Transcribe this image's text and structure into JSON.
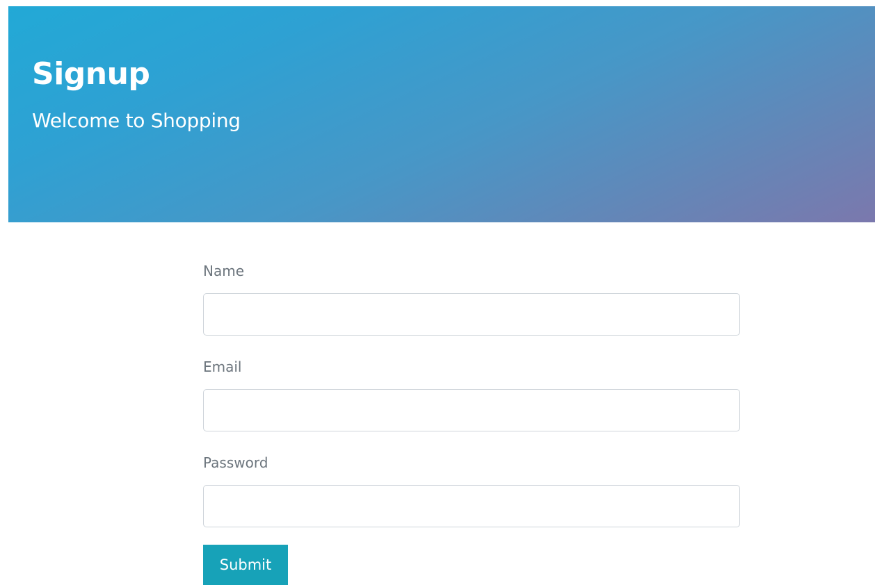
{
  "header": {
    "title": "Signup",
    "subtitle": "Welcome to Shopping"
  },
  "form": {
    "fields": [
      {
        "label": "Name",
        "value": "",
        "type": "text"
      },
      {
        "label": "Email",
        "value": "",
        "type": "email"
      },
      {
        "label": "Password",
        "value": "",
        "type": "password"
      }
    ],
    "submit_label": "Submit"
  },
  "colors": {
    "hero_gradient_start": "#22a9d6",
    "hero_gradient_end": "#7b78ad",
    "button_bg": "#17a2b8",
    "label_text": "#6c757d"
  }
}
